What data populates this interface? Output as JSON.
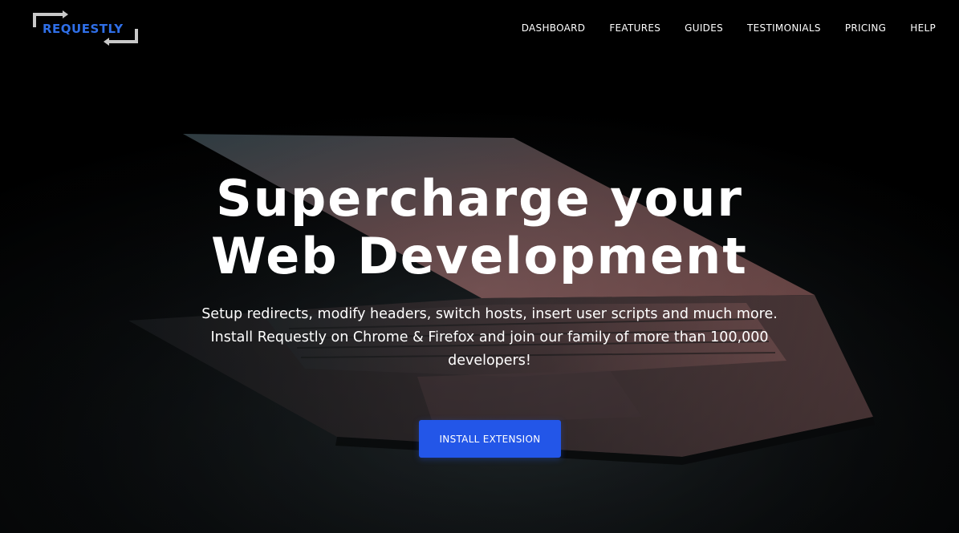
{
  "brand": {
    "logo_text": "REQUESTLY",
    "logo_color": "#2f6fe8"
  },
  "nav": {
    "items": [
      {
        "label": "DASHBOARD"
      },
      {
        "label": "FEATURES"
      },
      {
        "label": "GUIDES"
      },
      {
        "label": "TESTIMONIALS"
      },
      {
        "label": "PRICING"
      },
      {
        "label": "HELP"
      }
    ]
  },
  "hero": {
    "headline_line1": "Supercharge your",
    "headline_line2": "Web Development",
    "subtext_line1": "Setup redirects, modify headers, switch hosts, insert user scripts and much more.",
    "subtext_line2": "Install Requestly on Chrome & Firefox and join our family of more than 100,000",
    "subtext_line3": "developers!",
    "cta_label": "INSTALL EXTENSION",
    "cta_color": "#2356e8"
  }
}
